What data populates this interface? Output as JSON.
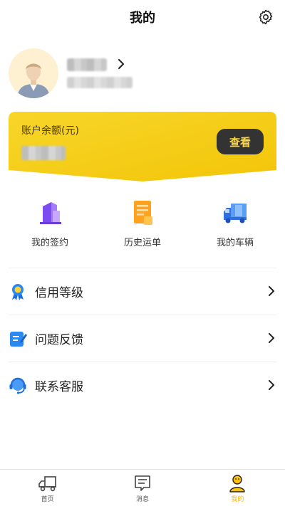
{
  "header": {
    "title": "我的"
  },
  "balance": {
    "label": "账户余额(元)",
    "view_label": "查看"
  },
  "quick_actions": [
    {
      "label": "我的签约",
      "icon": "contract-building-icon"
    },
    {
      "label": "历史运单",
      "icon": "waybill-document-icon"
    },
    {
      "label": "我的车辆",
      "icon": "truck-icon"
    }
  ],
  "menu": [
    {
      "label": "信用等级",
      "icon": "badge-icon"
    },
    {
      "label": "问题反馈",
      "icon": "feedback-edit-icon"
    },
    {
      "label": "联系客服",
      "icon": "headset-icon"
    }
  ],
  "nav": {
    "home": "首页",
    "messages": "消息",
    "mine": "我的"
  },
  "colors": {
    "accent": "#ffc107",
    "card_yellow": "#f6cf14",
    "view_button": "#333333",
    "active_tab": "#ffb400"
  }
}
